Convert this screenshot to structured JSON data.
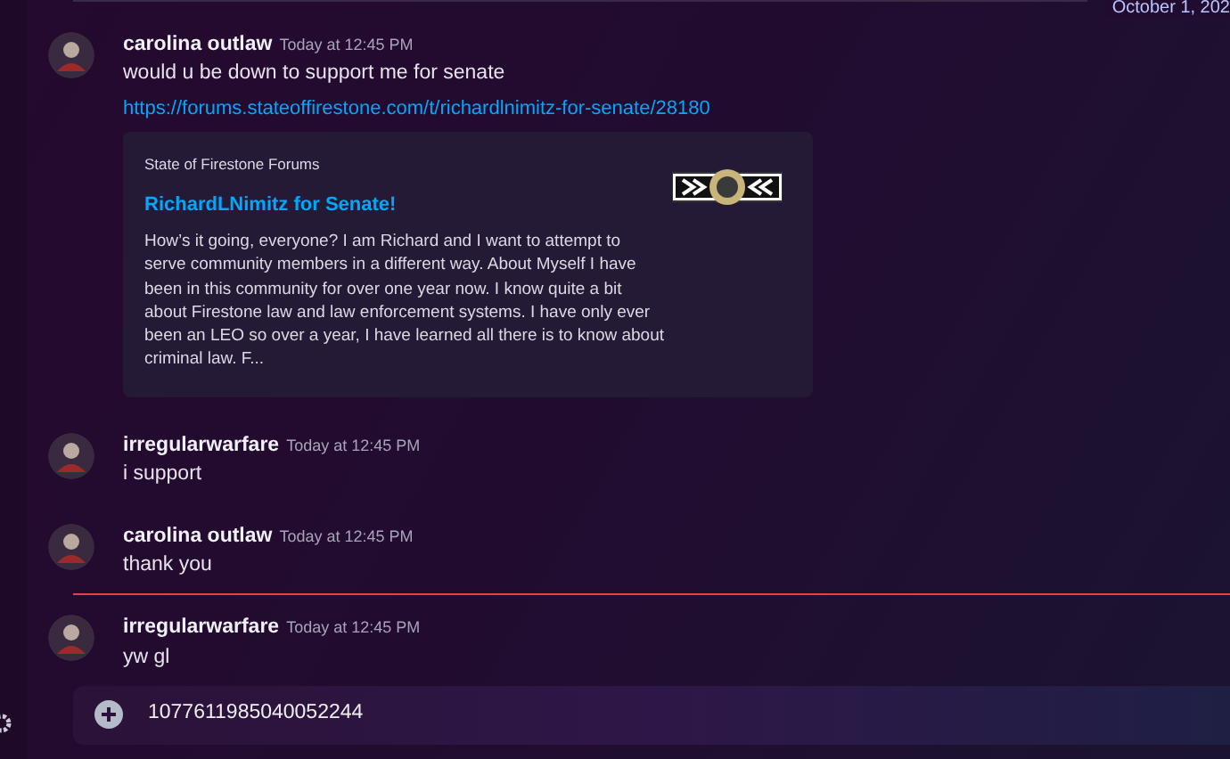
{
  "date_divider": {
    "label": "October 1, 202"
  },
  "messages": [
    {
      "author": "carolina outlaw",
      "timestamp": "Today at 12:45 PM",
      "new_marker": false,
      "text": "would u be down to support me for senate",
      "link": "https://forums.stateoffirestone.com/t/richardlnimitz-for-senate/28180",
      "embed": {
        "provider": "State of Firestone Forums",
        "title": "RichardLNimitz for Senate!",
        "description": "How’s it going, everyone? I am Richard and I want to attempt to serve community members in a different way. About Myself I have been in this community for over one year now. I know quite a bit about Firestone law and law enforcement systems. I have only ever been an LEO so over a year, I have learned all there is to know about criminal law. F..."
      }
    },
    {
      "author": "irregularwarfare",
      "timestamp": "Today at 12:45 PM",
      "new_marker": false,
      "text": "i support"
    },
    {
      "author": "carolina outlaw",
      "timestamp": "Today at 12:45 PM",
      "new_marker": false,
      "text": "thank you"
    },
    {
      "author": "irregularwarfare",
      "timestamp": "Today at 12:45 PM",
      "new_marker": true,
      "text": "yw gl"
    }
  ],
  "composer": {
    "value": "1077611985040052244"
  }
}
